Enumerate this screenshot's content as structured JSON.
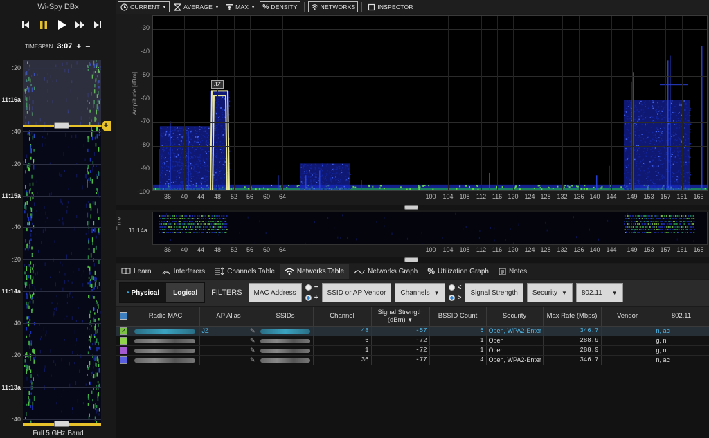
{
  "app": {
    "title": "Wi-Spy DBx"
  },
  "transport": {
    "icons": [
      "skip-back-icon",
      "pause-icon",
      "play-icon",
      "fast-forward-icon",
      "skip-forward-icon"
    ],
    "timespan_label": "TIMESPAN",
    "timespan_value": "3:07",
    "plus": "+",
    "minus": "−"
  },
  "left_waterfall": {
    "ticks": [
      ":20",
      "11:16a",
      ":40",
      ":20",
      "11:15a",
      ":40",
      ":20",
      "11:14a",
      ":40",
      ":20",
      "11:13a",
      ":40"
    ],
    "band_label": "Full 5 GHz Band",
    "plus": "+"
  },
  "toolbar": {
    "current": "CURRENT",
    "average": "AVERAGE",
    "max": "MAX",
    "density": "DENSITY",
    "networks": "NETWORKS",
    "inspector": "INSPECTOR"
  },
  "spectrum": {
    "axis_label": "Amplitude [dBm]",
    "amplitude_ticks": [
      "-30",
      "-40",
      "-50",
      "-60",
      "-70",
      "-80",
      "-90",
      "-100"
    ],
    "channels_low": [
      "36",
      "40",
      "44",
      "48",
      "52",
      "56",
      "60",
      "64"
    ],
    "channels_high": [
      "100",
      "104",
      "108",
      "112",
      "116",
      "120",
      "124",
      "128",
      "132",
      "136",
      "140",
      "144",
      "149",
      "153",
      "157",
      "161",
      "165"
    ],
    "network_tag": "JZ"
  },
  "timestrip": {
    "axis_label": "Time",
    "time_tick": "11:14a"
  },
  "tabs": [
    {
      "label": "Learn",
      "icon": "book-icon"
    },
    {
      "label": "Interferers",
      "icon": "signal-icon"
    },
    {
      "label": "Channels Table",
      "icon": "channels-table-icon"
    },
    {
      "label": "Networks Table",
      "icon": "wifi-icon"
    },
    {
      "label": "Networks Graph",
      "icon": "networks-graph-icon"
    },
    {
      "label": "Utilization Graph",
      "icon": "percent-icon"
    },
    {
      "label": "Notes",
      "icon": "notes-icon"
    }
  ],
  "filters": {
    "physical": "Physical",
    "logical": "Logical",
    "title": "FILTERS",
    "mac_address": "MAC Address",
    "minus": "−",
    "plus": "+",
    "ssid_vendor": "SSID or AP Vendor",
    "channels": "Channels",
    "lt": "<",
    "gt": ">",
    "signal_strength": "Signal Strength",
    "security": "Security",
    "standard": "802.11"
  },
  "table": {
    "headers": [
      "Radio MAC",
      "AP Alias",
      "SSIDs",
      "Channel",
      "Signal Strength (dBm)",
      "BSSID Count",
      "Security",
      "Max Rate (Mbps)",
      "Vendor",
      "802.11"
    ],
    "rows": [
      {
        "alias": "JZ",
        "channel": "48",
        "signal": "-57",
        "bssid": "5",
        "security": "Open, WPA2-Enter",
        "rate": "346.7",
        "vendor": "",
        "std": "n, ac",
        "color": "#7cc242",
        "checked": "✓"
      },
      {
        "alias": "",
        "channel": "6",
        "signal": "-72",
        "bssid": "1",
        "security": "Open",
        "rate": "288.9",
        "vendor": "",
        "std": "g, n",
        "color": "#8ed34a",
        "checked": ""
      },
      {
        "alias": "",
        "channel": "1",
        "signal": "-72",
        "bssid": "1",
        "security": "Open",
        "rate": "288.9",
        "vendor": "",
        "std": "g, n",
        "color": "#a35ad0",
        "checked": ""
      },
      {
        "alias": "",
        "channel": "36",
        "signal": "-77",
        "bssid": "4",
        "security": "Open, WPA2-Enter",
        "rate": "346.7",
        "vendor": "",
        "std": "n, ac",
        "color": "#5a5fe0",
        "checked": ""
      }
    ]
  }
}
